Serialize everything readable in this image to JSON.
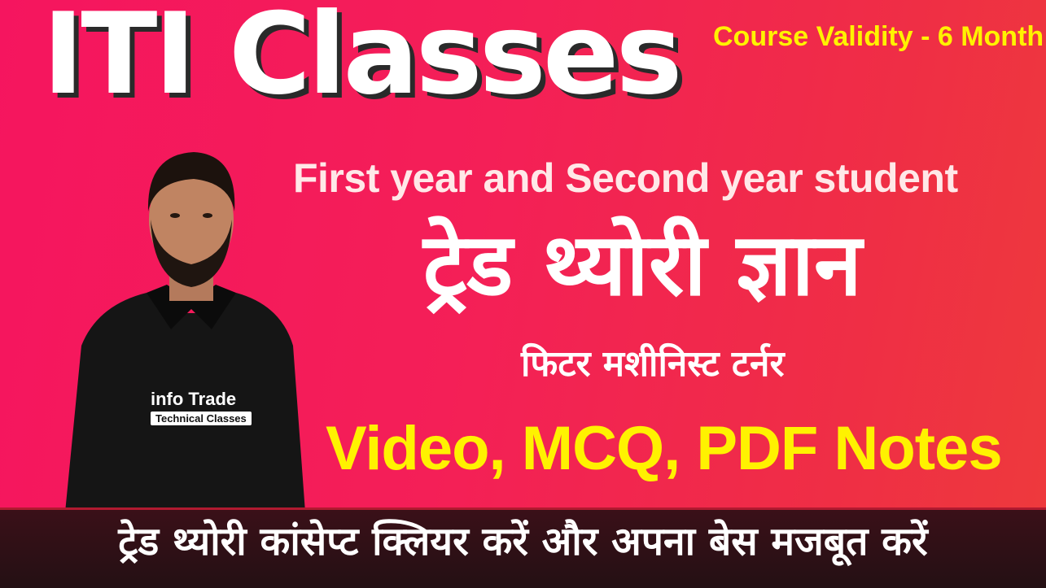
{
  "header": {
    "title": "ITI Classes",
    "validity": "Course Validity - 6 Month"
  },
  "main": {
    "subtitle": "First year and Second year student",
    "hindi_heading": "ट्रेड थ्योरी ज्ञान",
    "trades": "फिटर मशीनिस्ट टर्नर",
    "features": "Video, MCQ, PDF Notes"
  },
  "presenter": {
    "shirt_logo_line1": "info Trade",
    "shirt_logo_line2": "Technical Classes"
  },
  "footer": {
    "tagline": "ट्रेड थ्योरी कांसेप्ट क्लियर करें और अपना बेस मजबूत करें"
  },
  "colors": {
    "background": "#f41f57",
    "accent_yellow": "#fff200",
    "title_white": "#ffffff",
    "footer_bar": "#2a1016"
  }
}
